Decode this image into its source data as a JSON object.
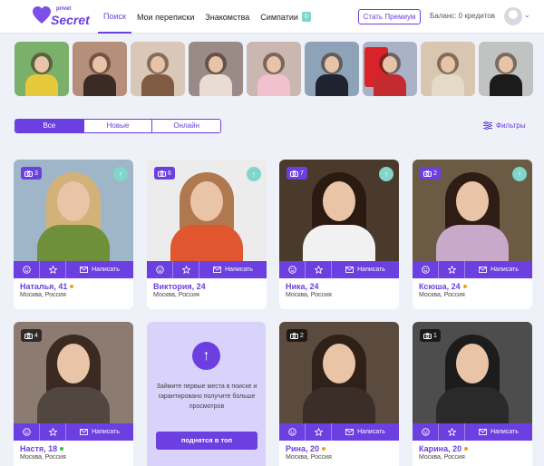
{
  "logo": {
    "small": "privet",
    "big": "Secret"
  },
  "nav": [
    {
      "label": "Поиск",
      "active": true
    },
    {
      "label": "Мои переписки"
    },
    {
      "label": "Знакомства"
    },
    {
      "label": "Симпатии",
      "badge": "0"
    }
  ],
  "header": {
    "premium_label": "Стать Премиум",
    "balance_text": "Баланс: 0 кредитов"
  },
  "stories": [
    {
      "bg": "#7ab06a",
      "body": "#e6c93b"
    },
    {
      "bg": "#b58f7a",
      "body": "#3a2c25"
    },
    {
      "bg": "#d9c7b7",
      "body": "#7f5b44"
    },
    {
      "bg": "#9a8b88",
      "body": "#e8dcd3"
    },
    {
      "bg": "#c9b7b0",
      "body": "#f0c1cf"
    },
    {
      "bg": "#8ea3b7",
      "body": "#1f2330"
    },
    {
      "bg": "#a9b3c5",
      "body": "#c42b30",
      "flag": true
    },
    {
      "bg": "#d8c6b0",
      "body": "#e4dac8"
    },
    {
      "bg": "#c1c3c2",
      "body": "#1b1b1b"
    }
  ],
  "tabs": [
    {
      "label": "Все",
      "active": true
    },
    {
      "label": "Новые"
    },
    {
      "label": "Онлайн"
    }
  ],
  "filters_label": "Фильтры",
  "write_label": "Написать",
  "cards": [
    {
      "name": "Наталья, 41",
      "city": "Москва, Россия",
      "photos": "3",
      "badge": "violet",
      "up": true,
      "online": "#f0a020",
      "bg": "#9fb6c8",
      "hair": "#d3b27a",
      "torso": "#6f8f3a"
    },
    {
      "name": "Виктория, 24",
      "city": "Москва, Россия",
      "photos": "6",
      "badge": "violet",
      "up": true,
      "online": "",
      "bg": "#ececec",
      "hair": "#b0784e",
      "torso": "#e0562e"
    },
    {
      "name": "Ника, 24",
      "city": "Москва, Россия",
      "photos": "7",
      "badge": "violet",
      "up": true,
      "online": "",
      "bg": "#4a3a2c",
      "hair": "#2a1a12",
      "torso": "#f1f1f1"
    },
    {
      "name": "Ксюша, 24",
      "city": "Москва, Россия",
      "photos": "2",
      "badge": "violet",
      "up": true,
      "online": "#f0a020",
      "bg": "#6b5a44",
      "hair": "#2d1d14",
      "torso": "#c8a9c9"
    },
    {
      "name": "Настя, 18",
      "city": "Москва, Россия",
      "photos": "4",
      "badge": "dark",
      "up": false,
      "online": "#2ec24a",
      "bg": "#8c7b70",
      "hair": "#3a2a22",
      "torso": "#514640"
    },
    {
      "name": "Рина, 20",
      "city": "Москва, Россия",
      "photos": "2",
      "badge": "dark",
      "up": false,
      "online": "#f0a020",
      "bg": "#5b4a3e",
      "hair": "#2f2018",
      "torso": "#3b2e28"
    },
    {
      "name": "Карина, 20",
      "city": "Москва, Россия",
      "photos": "1",
      "badge": "dark",
      "up": false,
      "online": "#f0a020",
      "bg": "#4d4d4d",
      "hair": "#1c1c1c",
      "torso": "#2a2a2a"
    }
  ],
  "promo": {
    "text": "Займите первые места в поиске и гарантировано получите больше просмотров",
    "button": "поднятся в топ"
  }
}
